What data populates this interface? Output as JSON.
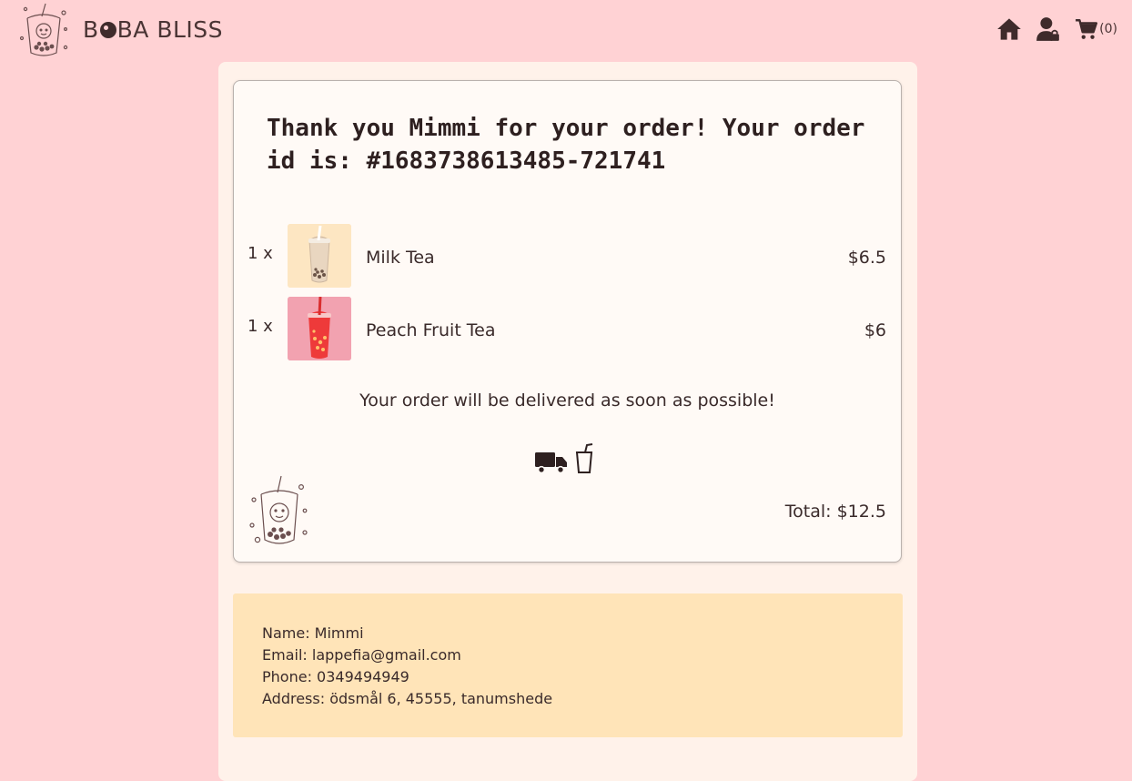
{
  "header": {
    "brand_first": "B",
    "brand_rest": "BA BLISS",
    "cart_count": "(0)",
    "icons": [
      "boba-logo-icon",
      "home-icon",
      "user-icon",
      "cart-icon"
    ]
  },
  "order": {
    "heading": "Thank you Mimmi for your order! Your order id is: #1683738613485-721741",
    "items": [
      {
        "qty": "1 x",
        "name": "Milk Tea",
        "price": "$6.5",
        "thumb_color": "#fde6c2"
      },
      {
        "qty": "1 x",
        "name": "Peach Fruit Tea",
        "price": "$6",
        "thumb_color": "#f2a2b0"
      }
    ],
    "delivery_message": "Your order will be delivered as soon as possible!",
    "total": "Total: $12.5"
  },
  "customer": {
    "name": "Name: Mimmi",
    "email": "Email: lappefia@gmail.com",
    "phone": "Phone: 0349494949",
    "address": "Address: ödsmål 6, 45555, tanumshede"
  },
  "colors": {
    "page_bg": "#ffd2d4",
    "panel_bg": "#fff2ea",
    "card_bg": "#fffaf6",
    "customer_bg": "#ffe4b8",
    "text": "#3a2a2a"
  }
}
